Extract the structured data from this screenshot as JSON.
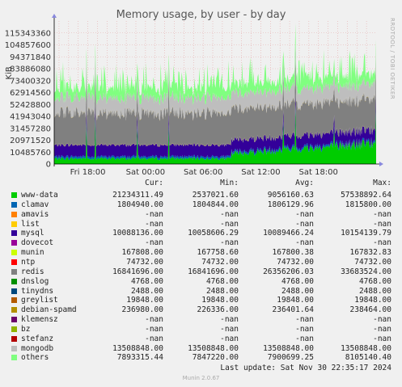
{
  "title": "Memory usage, by user - by day",
  "side_text": "RRDTOOL / TOBI OETIKER",
  "chart_data": {
    "type": "area",
    "ylabel": "KiB",
    "ylim": [
      0,
      125829120
    ],
    "y_ticks": [
      0,
      10485760,
      20971520,
      31457280,
      41943040,
      52428800,
      62914560,
      73400320,
      83886080,
      94371840,
      104857600,
      115343360
    ],
    "y_tick_labels": [
      "0",
      "10485760",
      "20971520",
      "31457280",
      "41943040",
      "52428800",
      "62914560",
      "73400320",
      "83886080",
      "94371840",
      "104857600",
      "115343360"
    ],
    "x_range_hours": [
      0,
      33.5
    ],
    "x_ticks": [
      {
        "label": "Fri 18:00",
        "hour": 3.5
      },
      {
        "label": "Sat 00:00",
        "hour": 9.5
      },
      {
        "label": "Sat 06:00",
        "hour": 15.5
      },
      {
        "label": "Sat 12:00",
        "hour": 21.5
      },
      {
        "label": "Sat 18:00",
        "hour": 27.5
      }
    ],
    "columns": [
      "Cur:",
      "Min:",
      "Avg:",
      "Max:"
    ],
    "series": [
      {
        "name": "www-data",
        "color": "#00cc00",
        "cur": "21234311.49",
        "min": "2537021.60",
        "avg": "9056160.63",
        "max": "57538892.64"
      },
      {
        "name": "clamav",
        "color": "#0066b3",
        "cur": "1804940.00",
        "min": "1804844.00",
        "avg": "1806129.96",
        "max": "1815800.00"
      },
      {
        "name": "amavis",
        "color": "#ff8000",
        "cur": "-nan",
        "min": "-nan",
        "avg": "-nan",
        "max": "-nan"
      },
      {
        "name": "list",
        "color": "#ffcc00",
        "cur": "-nan",
        "min": "-nan",
        "avg": "-nan",
        "max": "-nan"
      },
      {
        "name": "mysql",
        "color": "#330099",
        "cur": "10088136.00",
        "min": "10058606.29",
        "avg": "10089466.24",
        "max": "10154139.79"
      },
      {
        "name": "dovecot",
        "color": "#990099",
        "cur": "-nan",
        "min": "-nan",
        "avg": "-nan",
        "max": "-nan"
      },
      {
        "name": "munin",
        "color": "#ccff00",
        "cur": "167808.00",
        "min": "167758.60",
        "avg": "167800.38",
        "max": "167832.83"
      },
      {
        "name": "ntp",
        "color": "#ff0000",
        "cur": "74732.00",
        "min": "74732.00",
        "avg": "74732.00",
        "max": "74732.00"
      },
      {
        "name": "redis",
        "color": "#808080",
        "cur": "16841696.00",
        "min": "16841696.00",
        "avg": "26356206.03",
        "max": "33683524.00"
      },
      {
        "name": "dnslog",
        "color": "#008f00",
        "cur": "4768.00",
        "min": "4768.00",
        "avg": "4768.00",
        "max": "4768.00"
      },
      {
        "name": "tinydns",
        "color": "#00487d",
        "cur": "2488.00",
        "min": "2488.00",
        "avg": "2488.00",
        "max": "2488.00"
      },
      {
        "name": "greylist",
        "color": "#b35a00",
        "cur": "19848.00",
        "min": "19848.00",
        "avg": "19848.00",
        "max": "19848.00"
      },
      {
        "name": "debian-spamd",
        "color": "#b38f00",
        "cur": "236980.00",
        "min": "226336.00",
        "avg": "236401.64",
        "max": "238464.00"
      },
      {
        "name": "klemensz",
        "color": "#6b006b",
        "cur": "-nan",
        "min": "-nan",
        "avg": "-nan",
        "max": "-nan"
      },
      {
        "name": "bz",
        "color": "#8fb300",
        "cur": "-nan",
        "min": "-nan",
        "avg": "-nan",
        "max": "-nan"
      },
      {
        "name": "stefanz",
        "color": "#b30000",
        "cur": "-nan",
        "min": "-nan",
        "avg": "-nan",
        "max": "-nan"
      },
      {
        "name": "mongodb",
        "color": "#bebebe",
        "cur": "13508848.00",
        "min": "13508848.00",
        "avg": "13508848.00",
        "max": "13508848.00"
      },
      {
        "name": "others",
        "color": "#80ff80",
        "cur": "7893315.44",
        "min": "7847220.00",
        "avg": "7900699.25",
        "max": "8105140.40"
      }
    ]
  },
  "last_update": "Last update: Sat Nov 30 22:35:17 2024",
  "version": "Munin 2.0.67"
}
